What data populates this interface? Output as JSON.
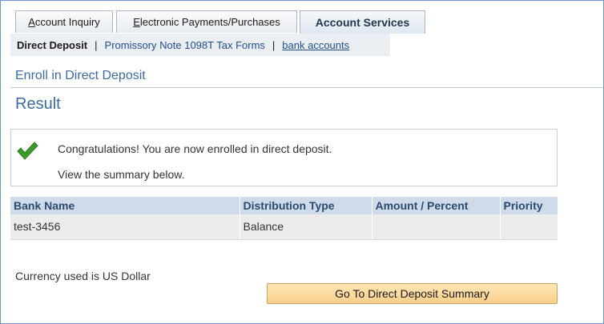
{
  "tabs": [
    {
      "label_ul": "A",
      "label_rest": "ccount Inquiry"
    },
    {
      "label_ul": "E",
      "label_rest": "lectronic Payments/Purchases"
    },
    {
      "label": "Account Services"
    }
  ],
  "subnav": {
    "current": "Direct Deposit",
    "separator": "|",
    "link1": "Promissory Note 1098T Tax Forms",
    "link2": "bank accounts"
  },
  "page_heading": "Enroll in Direct Deposit",
  "result_title": "Result",
  "message": {
    "icon": "checkmark-icon",
    "line1": "Congratulations! You are now enrolled in direct deposit.",
    "line2": "View the summary below."
  },
  "table": {
    "columns": [
      "Bank Name",
      "Distribution Type",
      "Amount / Percent",
      "Priority"
    ],
    "rows": [
      [
        "test-3456",
        "Balance",
        "",
        ""
      ]
    ]
  },
  "currency_note": "Currency used is US Dollar",
  "summary_button": "Go To Direct Deposit Summary",
  "colors": {
    "link": "#1f4f8c",
    "heading": "#3b6ba5",
    "table_header_bg": "#cfdbe8",
    "button_bg": "#f8cf8a",
    "check": "#3a9b2a"
  }
}
